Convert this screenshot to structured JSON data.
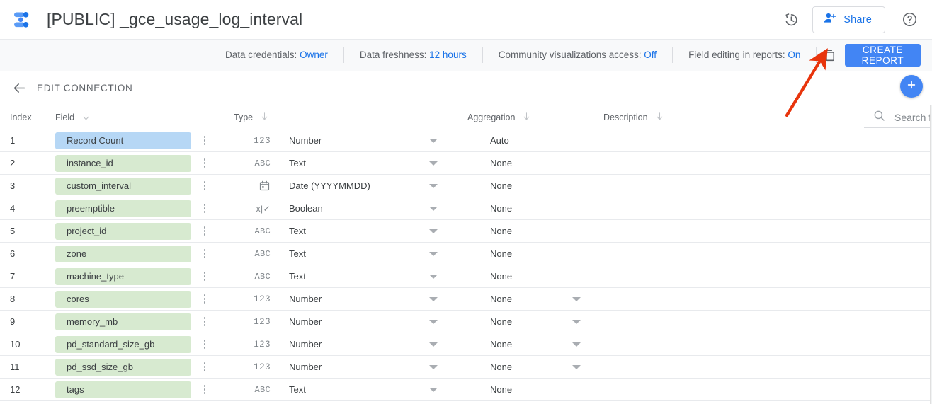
{
  "header": {
    "logo_icon": "data-studio-logo-icon",
    "title": "[PUBLIC] _gce_usage_log_interval",
    "history_icon": "version-history-icon",
    "share_label": "Share",
    "share_icon": "person-add-icon",
    "help_icon": "help-circle-icon"
  },
  "infobar": {
    "items": [
      {
        "label": "Data credentials:",
        "value": "Owner"
      },
      {
        "label": "Data freshness:",
        "value": "12 hours"
      },
      {
        "label": "Community visualizations access:",
        "value": "Off"
      },
      {
        "label": "Field editing in reports:",
        "value": "On"
      }
    ],
    "copy_icon": "copy-duplicate-icon",
    "create_report_label": "CREATE REPORT"
  },
  "editbar": {
    "back_icon": "arrow-left-icon",
    "label": "EDIT CONNECTION",
    "add_field_icon": "plus-icon"
  },
  "table": {
    "columns": {
      "index": "Index",
      "field": "Field",
      "type": "Type",
      "aggregation": "Aggregation",
      "description": "Description"
    },
    "sort_icon": "sort-down-arrow-icon",
    "search": {
      "icon": "search-icon",
      "placeholder": "Search fields",
      "value": ""
    },
    "rows": [
      {
        "index": "1",
        "field": "Record Count",
        "chip": "metric",
        "type_icon": "123",
        "type": "Number",
        "aggregation": "Auto",
        "agg_caret": false,
        "description": ""
      },
      {
        "index": "2",
        "field": "instance_id",
        "chip": "dimension",
        "type_icon": "ABC",
        "type": "Text",
        "aggregation": "None",
        "agg_caret": false,
        "description": ""
      },
      {
        "index": "3",
        "field": "custom_interval",
        "chip": "dimension",
        "type_icon": "date",
        "type": "Date (YYYYMMDD)",
        "aggregation": "None",
        "agg_caret": false,
        "description": ""
      },
      {
        "index": "4",
        "field": "preemptible",
        "chip": "dimension",
        "type_icon": "bool",
        "type": "Boolean",
        "aggregation": "None",
        "agg_caret": false,
        "description": ""
      },
      {
        "index": "5",
        "field": "project_id",
        "chip": "dimension",
        "type_icon": "ABC",
        "type": "Text",
        "aggregation": "None",
        "agg_caret": false,
        "description": ""
      },
      {
        "index": "6",
        "field": "zone",
        "chip": "dimension",
        "type_icon": "ABC",
        "type": "Text",
        "aggregation": "None",
        "agg_caret": false,
        "description": ""
      },
      {
        "index": "7",
        "field": "machine_type",
        "chip": "dimension",
        "type_icon": "ABC",
        "type": "Text",
        "aggregation": "None",
        "agg_caret": false,
        "description": ""
      },
      {
        "index": "8",
        "field": "cores",
        "chip": "dimension",
        "type_icon": "123",
        "type": "Number",
        "aggregation": "None",
        "agg_caret": true,
        "description": ""
      },
      {
        "index": "9",
        "field": "memory_mb",
        "chip": "dimension",
        "type_icon": "123",
        "type": "Number",
        "aggregation": "None",
        "agg_caret": true,
        "description": ""
      },
      {
        "index": "10",
        "field": "pd_standard_size_gb",
        "chip": "dimension",
        "type_icon": "123",
        "type": "Number",
        "aggregation": "None",
        "agg_caret": true,
        "description": ""
      },
      {
        "index": "11",
        "field": "pd_ssd_size_gb",
        "chip": "dimension",
        "type_icon": "123",
        "type": "Number",
        "aggregation": "None",
        "agg_caret": true,
        "description": ""
      },
      {
        "index": "12",
        "field": "tags",
        "chip": "dimension",
        "type_icon": "ABC",
        "type": "Text",
        "aggregation": "None",
        "agg_caret": false,
        "description": ""
      }
    ]
  },
  "annotation": {
    "type": "red-arrow",
    "color": "#e8340c",
    "points_to": "copy-duplicate-icon"
  },
  "colors": {
    "accent_blue": "#4285f4",
    "link_blue": "#1a73e8",
    "metric_chip": "#b6d7f5",
    "dimension_chip": "#d7ead0",
    "annotation_red": "#e8340c"
  }
}
